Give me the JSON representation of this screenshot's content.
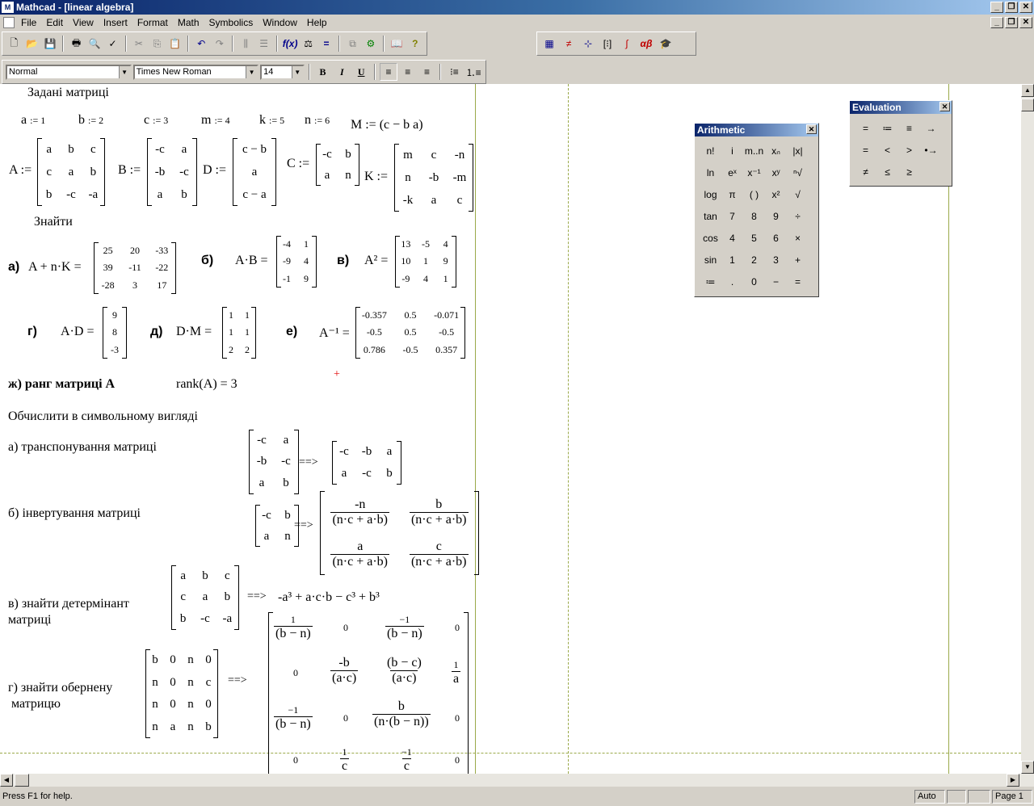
{
  "window": {
    "title": "Mathcad - [linear algebra]",
    "icon": "Mathcad-logo-icon"
  },
  "menu": [
    "File",
    "Edit",
    "View",
    "Insert",
    "Format",
    "Math",
    "Symbolics",
    "Window",
    "Help"
  ],
  "format": {
    "style": "Normal",
    "font": "Times New Roman",
    "size": "14",
    "bold": "B",
    "italic": "I",
    "underline": "U"
  },
  "doc": {
    "given_title": "Задані матриці",
    "scalars": [
      {
        "name": "a",
        "val": "1"
      },
      {
        "name": "b",
        "val": "2"
      },
      {
        "name": "c",
        "val": "3"
      },
      {
        "name": "m",
        "val": "4"
      },
      {
        "name": "k",
        "val": "5"
      },
      {
        "name": "n",
        "val": "6"
      }
    ],
    "M_def": "M := (c − b   a)",
    "A": {
      "name": "A :=",
      "rows": [
        [
          "a",
          "b",
          "c"
        ],
        [
          "c",
          "a",
          "b"
        ],
        [
          "b",
          "-c",
          "-a"
        ]
      ]
    },
    "B": {
      "name": "B :=",
      "rows": [
        [
          "-c",
          "a"
        ],
        [
          "-b",
          "-c"
        ],
        [
          "a",
          "b"
        ]
      ]
    },
    "D": {
      "name": "D :=",
      "rows": [
        [
          "c − b"
        ],
        [
          "a"
        ],
        [
          "c − a"
        ]
      ]
    },
    "C": {
      "name": "C :=",
      "rows": [
        [
          "-c",
          "b"
        ],
        [
          "a",
          "n"
        ]
      ]
    },
    "K": {
      "name": "K :=",
      "rows": [
        [
          "m",
          "c",
          "-n"
        ],
        [
          "n",
          "-b",
          "-m"
        ],
        [
          "-k",
          "a",
          "c"
        ]
      ]
    },
    "find_title": "Знайти",
    "r1": {
      "label": "а)",
      "expr": "A + n·K =",
      "rows": [
        [
          "25",
          "20",
          "-33"
        ],
        [
          "39",
          "-11",
          "-22"
        ],
        [
          "-28",
          "3",
          "17"
        ]
      ]
    },
    "r2": {
      "label": "б)",
      "expr": "A·B =",
      "rows": [
        [
          "-4",
          "1"
        ],
        [
          "-9",
          "4"
        ],
        [
          "-1",
          "9"
        ]
      ]
    },
    "r3": {
      "label": "в)",
      "expr": "A² =",
      "rows": [
        [
          "13",
          "-5",
          "4"
        ],
        [
          "10",
          "1",
          "9"
        ],
        [
          "-9",
          "4",
          "1"
        ]
      ]
    },
    "r4": {
      "label": "г)",
      "expr": "A·D =",
      "rows": [
        [
          "9"
        ],
        [
          "8"
        ],
        [
          "-3"
        ]
      ]
    },
    "r5": {
      "label": "д)",
      "expr": "D·M =",
      "rows": [
        [
          "1",
          "1"
        ],
        [
          "1",
          "1"
        ],
        [
          "2",
          "2"
        ]
      ]
    },
    "r6": {
      "label": "е)",
      "expr": "A⁻¹ =",
      "rows": [
        [
          "-0.357",
          "0.5",
          "-0.071"
        ],
        [
          "-0.5",
          "0.5",
          "-0.5"
        ],
        [
          "0.786",
          "-0.5",
          "0.357"
        ]
      ]
    },
    "rank_text": "ж) ранг матриці А",
    "rank_expr": "rank(A) = 3",
    "symbolic_title": "Обчислити в символьному вигляді",
    "s1_label": "а) транспонування матриці",
    "s1_in": [
      [
        "-c",
        "a"
      ],
      [
        "-b",
        "-c"
      ],
      [
        "a",
        "b"
      ]
    ],
    "s1_out": [
      [
        "-c",
        "-b",
        "a"
      ],
      [
        "a",
        "-c",
        "b"
      ]
    ],
    "s2_label": "б) інвертування матриці",
    "s2_in": [
      [
        "-c",
        "b"
      ],
      [
        "a",
        "n"
      ]
    ],
    "s2_out": [
      [
        "-n",
        "(n·c + a·b)",
        "b",
        "(n·c + a·b)"
      ],
      [
        "a",
        "(n·c + a·b)",
        "c",
        "(n·c + a·b)"
      ]
    ],
    "s3_label_1": "в) знайти детермінант",
    "s3_label_2": "матриці",
    "s3_in": [
      [
        "a",
        "b",
        "c"
      ],
      [
        "c",
        "a",
        "b"
      ],
      [
        "b",
        "-c",
        "-a"
      ]
    ],
    "s3_out": "-a³ + a·c·b − c³ + b³",
    "s4_label_1": "г) знайти обернену",
    "s4_label_2": "матрицю",
    "s4_in": [
      [
        "b",
        "0",
        "n",
        "0"
      ],
      [
        "n",
        "0",
        "n",
        "c"
      ],
      [
        "n",
        "0",
        "n",
        "0"
      ],
      [
        "n",
        "a",
        "n",
        "b"
      ]
    ],
    "arrow": "==>"
  },
  "arithmetic": {
    "title": "Arithmetic",
    "keys": [
      "n!",
      "i",
      "m..n",
      "xₙ",
      "|x|",
      "ln",
      "eˣ",
      "x⁻¹",
      "xʸ",
      "ⁿ√",
      "log",
      "π",
      "( )",
      "x²",
      "√",
      "tan",
      "7",
      "8",
      "9",
      "÷",
      "cos",
      "4",
      "5",
      "6",
      "×",
      "sin",
      "1",
      "2",
      "3",
      "+",
      "≔",
      ".",
      "0",
      "−",
      "="
    ]
  },
  "evaluation": {
    "title": "Evaluation",
    "keys": [
      "=",
      "≔",
      "≡",
      "→",
      "=",
      "<",
      ">",
      "•→",
      "≠",
      "≤",
      "≥"
    ]
  },
  "status": {
    "help": "Press F1 for help.",
    "mode": "Auto",
    "page": "Page 1"
  }
}
